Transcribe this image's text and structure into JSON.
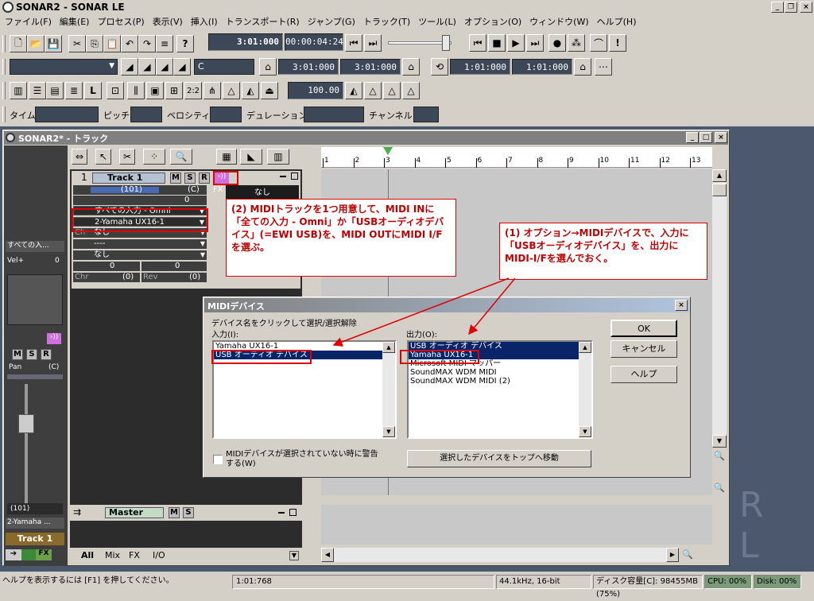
{
  "app": {
    "title": "SONAR2 - SONAR LE",
    "close": "×"
  },
  "menu": [
    "ファイル(F)",
    "編集(E)",
    "プロセス(P)",
    "表示(V)",
    "挿入(I)",
    "トランスポート(R)",
    "ジャンプ(G)",
    "トラック(T)",
    "ツール(L)",
    "オプション(O)",
    "ウィンドウ(W)",
    "ヘルプ(H)"
  ],
  "transport": {
    "now": "3:01:000",
    "smpte": "00:00:04:24"
  },
  "toolbar2": {
    "key": "C",
    "from": "3:01:000",
    "thru": "3:01:000",
    "loop_from": "1:01:000",
    "loop_thru": "1:01:000"
  },
  "toolbar3": {
    "zoom": "100.00"
  },
  "event_bar": {
    "time": "タイム",
    "pitch": "ピッチ",
    "velocity": "ベロシティ",
    "duration": "デュレーション",
    "channel": "チャンネル"
  },
  "track_window": {
    "title": "SONAR2* - トラック",
    "ruler": [
      "1",
      "2",
      "3",
      "4",
      "5",
      "6",
      "7",
      "8",
      "9",
      "10",
      "11",
      "12",
      "13"
    ]
  },
  "track": {
    "number": "1",
    "name": "Track 1",
    "vol": "(101)",
    "pan": "(C)",
    "vel": "0",
    "fx_label": "FX",
    "fx_value": "なし",
    "input": "すべての入力 - Omni",
    "output": "2-Yamaha UX16-1",
    "ch_label": "Ch",
    "ch": "なし",
    "bank": "----",
    "patch": "なし",
    "key": "0",
    "time": "0",
    "chr_label": "Chr",
    "chr": "(0)",
    "rev_label": "Rev",
    "rev": "(0)",
    "m": "M",
    "s": "S",
    "r": "R"
  },
  "strip": {
    "input": "すべての入...",
    "vel_label": "Vel+",
    "vel": "0",
    "pan_label": "Pan",
    "pan": "(C)",
    "vol": "(101)",
    "output": "2-Yamaha ...",
    "name": "Track 1"
  },
  "master": {
    "name": "Master",
    "m": "M",
    "s": "S"
  },
  "tabs": [
    "All",
    "Mix",
    "FX",
    "I/O"
  ],
  "dialog": {
    "title": "MIDIデバイス",
    "instruction": "デバイス名をクリックして選択/選択解除",
    "input_label": "入力(I):",
    "output_label": "出力(O):",
    "inputs": [
      "Yamaha UX16-1",
      "USB オーディオ デバイス"
    ],
    "outputs": [
      "USB オーディオ デバイス",
      "Yamaha UX16-1",
      "Microsoft MIDI マッパー",
      "SoundMAX WDM MIDI",
      "SoundMAX WDM MIDI (2)"
    ],
    "ok": "OK",
    "cancel": "キャンセル",
    "help": "ヘルプ",
    "checkbox": "MIDIデバイスが選択されていない時に警告する(W)",
    "move_top": "選択したデバイスをトップへ移動"
  },
  "callouts": {
    "one": "(1) オプション→MIDIデバイスで、入力に「USBオーディオデバイス」を、出力にMIDI-I/Fを選んでおく。",
    "two": "(2) MIDIトラックを1つ用意して、MIDI INに「全ての入力 - Omni」か「USBオーディオデバイス」(=EWI USB)を、MIDI OUTにMIDI I/Fを選ぶ。"
  },
  "status": {
    "help": "ヘルプを表示するには [F1] を押してください。",
    "time": "1:01:768",
    "format": "44.1kHz, 16-bit",
    "disk": "ディスク容量[C]: 98455MB (75%)",
    "cpu": "CPU: 00%",
    "disk_io": "Disk: 00%"
  },
  "watermark": "R  L"
}
